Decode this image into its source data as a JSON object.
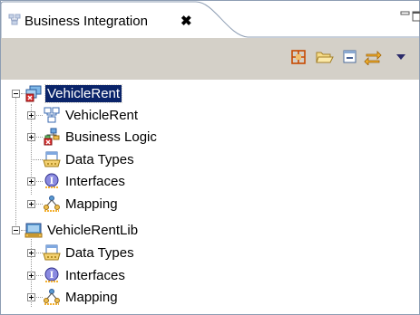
{
  "view": {
    "tab_title": "Business Integration",
    "close_glyph": "✖"
  },
  "toolbar": {
    "icons": [
      "link-icon",
      "open-folder-icon",
      "collapse-all-icon",
      "sync-icon",
      "view-menu-dropdown-icon"
    ]
  },
  "tree": {
    "module": {
      "label": "VehicleRent",
      "children": [
        "VehicleRent",
        "Business Logic",
        "Data Types",
        "Interfaces",
        "Mapping"
      ]
    },
    "library": {
      "label": "VehicleRentLib",
      "children": [
        "Data Types",
        "Interfaces",
        "Mapping"
      ]
    }
  },
  "colors": {
    "selection": "#0a246a",
    "toolbar_bg": "#d4d0c8",
    "tab_border": "#8d9db3"
  }
}
